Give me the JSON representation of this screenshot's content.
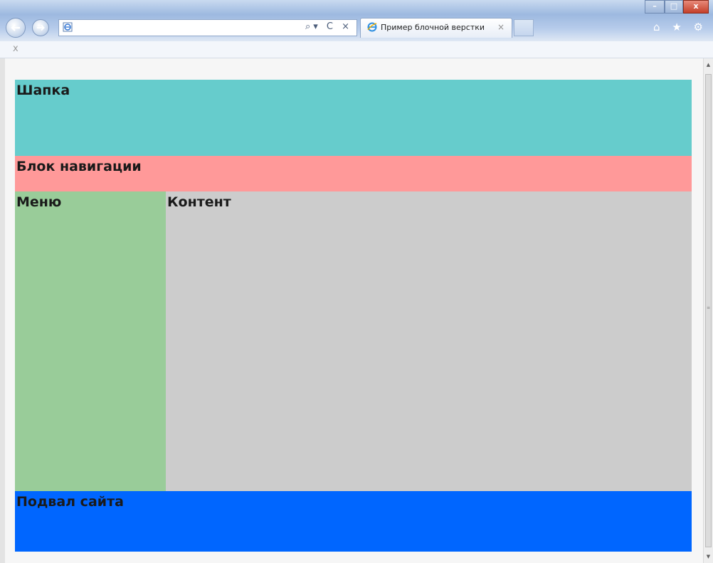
{
  "browser": {
    "tab_title": "Пример блочной верстки",
    "tab_close": "×",
    "address_tools": "⌕▾ C ×",
    "command_close": "x",
    "window_controls": {
      "minimize": "–",
      "maximize": "□",
      "close": "x"
    },
    "toolbar_icons": "⌂ ★ ⚙"
  },
  "page": {
    "header": "Шапка",
    "navigation": "Блок навигации",
    "menu": "Меню",
    "content": "Контент",
    "footer": "Подвал сайта"
  },
  "colors": {
    "header": "#66cccc",
    "navigation": "#ff9999",
    "menu": "#99cc99",
    "content": "#cccccc",
    "footer": "#0066ff"
  }
}
